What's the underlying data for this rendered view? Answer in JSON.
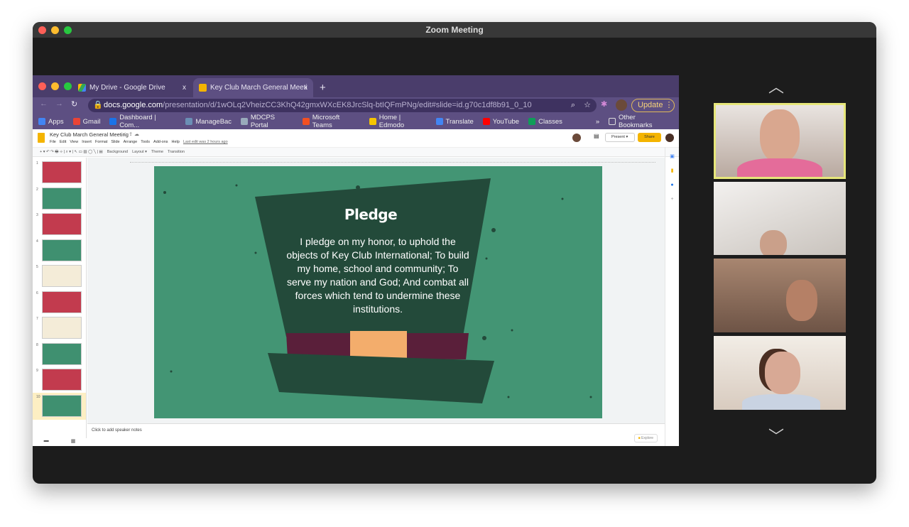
{
  "window": {
    "title": "Zoom Meeting"
  },
  "browser": {
    "tabs": [
      {
        "label": "My Drive - Google Drive",
        "close": "x",
        "icon": "google-drive-icon"
      },
      {
        "label": "Key Club March General Meeti",
        "close": "x",
        "icon": "google-slides-icon"
      }
    ],
    "new_tab": "+",
    "url_host": "docs.google.com",
    "url_path": "/presentation/d/1wOLq2VheizCC3KhQ42gmxWXcEK8JrcSlq-btIQFmPNg/edit#slide=id.g70c1df8b91_0_10",
    "update_label": "Update",
    "bookmarks": [
      {
        "label": "Apps",
        "color": "#4285f4"
      },
      {
        "label": "Gmail",
        "color": "#ea4335"
      },
      {
        "label": "Dashboard | Com...",
        "color": "#1a73e8"
      },
      {
        "label": "ManageBac",
        "color": "#6b8fb5"
      },
      {
        "label": "MDCPS Portal",
        "color": "#9ab"
      },
      {
        "label": "Microsoft Teams",
        "color": "#f25022"
      },
      {
        "label": "Home | Edmodo",
        "color": "#f5c400"
      },
      {
        "label": "Translate",
        "color": "#4285f4"
      },
      {
        "label": "YouTube",
        "color": "#ff0000"
      },
      {
        "label": "Classes",
        "color": "#0f9d58"
      }
    ],
    "more_bookmarks": "»",
    "other_bookmarks": "Other Bookmarks"
  },
  "docs": {
    "title": "Key Club March General Meeting",
    "menu": [
      "File",
      "Edit",
      "View",
      "Insert",
      "Format",
      "Slide",
      "Arrange",
      "Tools",
      "Add-ons",
      "Help"
    ],
    "last_edit": "Last edit was 2 hours ago",
    "present": "Present",
    "share": "Share",
    "toolbar": [
      "Background",
      "Layout ▾",
      "Theme",
      "Transition"
    ],
    "slide_numbers": [
      "1",
      "2",
      "3",
      "4",
      "5",
      "6",
      "7",
      "8",
      "9",
      "10"
    ],
    "thumb_colors": [
      "#c23b4e",
      "#3f9070",
      "#c23b4e",
      "#3f9070",
      "#f4ecd8",
      "#c23b4e",
      "#f4ecd8",
      "#3f9070",
      "#c23b4e",
      "#3f9070"
    ],
    "selected_slide": 10,
    "notes_placeholder": "Click to add speaker notes",
    "explore": "Explore"
  },
  "slide": {
    "title": "Pledge",
    "body": "I pledge on my honor, to uphold the objects of Key Club International; To build my home, school and community; To serve my nation and God; And combat all forces which tend to undermine these institutions.",
    "colors": {
      "background": "#439574",
      "hat": "#234a3a",
      "band": "#5a1f3a",
      "buckle": "#f3ad6c"
    }
  },
  "zoom": {
    "active_speaker_border": "#e6e67a",
    "participants": 4
  }
}
